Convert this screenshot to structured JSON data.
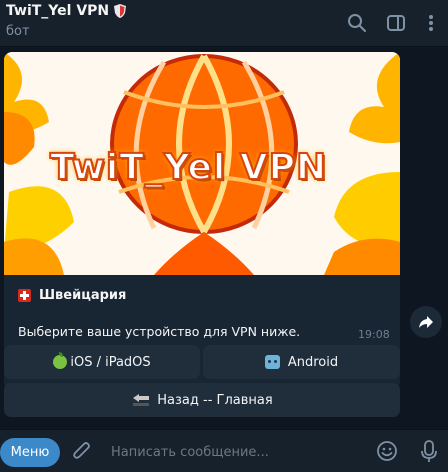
{
  "header": {
    "title": "TwiT_Yel VPN",
    "subtitle": "бот",
    "icons": [
      "shield-icon",
      "search-icon",
      "sidebar-toggle-icon",
      "more-vertical-icon"
    ]
  },
  "message": {
    "image_caption_text": "TwiT_Yel VPN",
    "country_flag_icon": "swiss-flag-icon",
    "country": "Швейцария",
    "text": "Выберите ваше устройство для VPN ниже.",
    "time": "19:08"
  },
  "keyboard": {
    "ios_label": "iOS /  iPadOS",
    "android_label": "Android",
    "back_label": "Назад -- Главная"
  },
  "input_bar": {
    "menu_label": "Меню",
    "placeholder": "Написать сообщение..."
  },
  "colors": {
    "background": "#0e1621",
    "panel": "#17212b",
    "bubble": "#182533",
    "button": "#202e3c",
    "accent": "#3b89c9"
  }
}
